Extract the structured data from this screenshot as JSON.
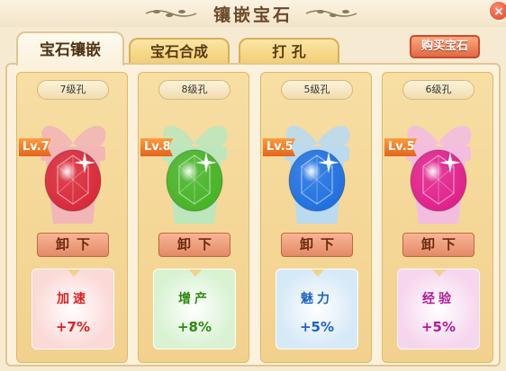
{
  "window": {
    "title": "镶嵌宝石",
    "close_label": "×"
  },
  "tabs": [
    {
      "label": "宝石镶嵌",
      "active": true
    },
    {
      "label": "宝石合成",
      "active": false
    },
    {
      "label": "打 孔",
      "active": false
    }
  ],
  "buy_button": "购买宝石",
  "gems": [
    {
      "slot": "7级孔",
      "level": "Lv.7",
      "gem_color": "#d8283a",
      "pot_color": "#f2b6b6",
      "unload": "卸下",
      "bonus_name": "加速",
      "bonus_value": "+7%",
      "bonus_color": "#e02020",
      "bonus_bg": "#fbd9d7",
      "gem_icon": "red-gem-icon"
    },
    {
      "slot": "8级孔",
      "level": "Lv.8",
      "gem_color": "#46b325",
      "pot_color": "#bde6bd",
      "unload": "卸下",
      "bonus_name": "增产",
      "bonus_value": "+8%",
      "bonus_color": "#2e8a12",
      "bonus_bg": "#d8f2d2",
      "gem_icon": "green-gem-icon"
    },
    {
      "slot": "5级孔",
      "level": "Lv.5",
      "gem_color": "#1f6fe0",
      "pot_color": "#b9daf0",
      "unload": "卸下",
      "bonus_name": "魅力",
      "bonus_value": "+5%",
      "bonus_color": "#1b62c8",
      "bonus_bg": "#d6e9f7",
      "gem_icon": "blue-gem-icon"
    },
    {
      "slot": "6级孔",
      "level": "Lv.5",
      "gem_color": "#e01f8a",
      "pot_color": "#f3bde0",
      "unload": "卸下",
      "bonus_name": "经验",
      "bonus_value": "+5%",
      "bonus_color": "#b21a9a",
      "bonus_bg": "#f6d6ee",
      "gem_icon": "pink-gem-icon"
    }
  ]
}
